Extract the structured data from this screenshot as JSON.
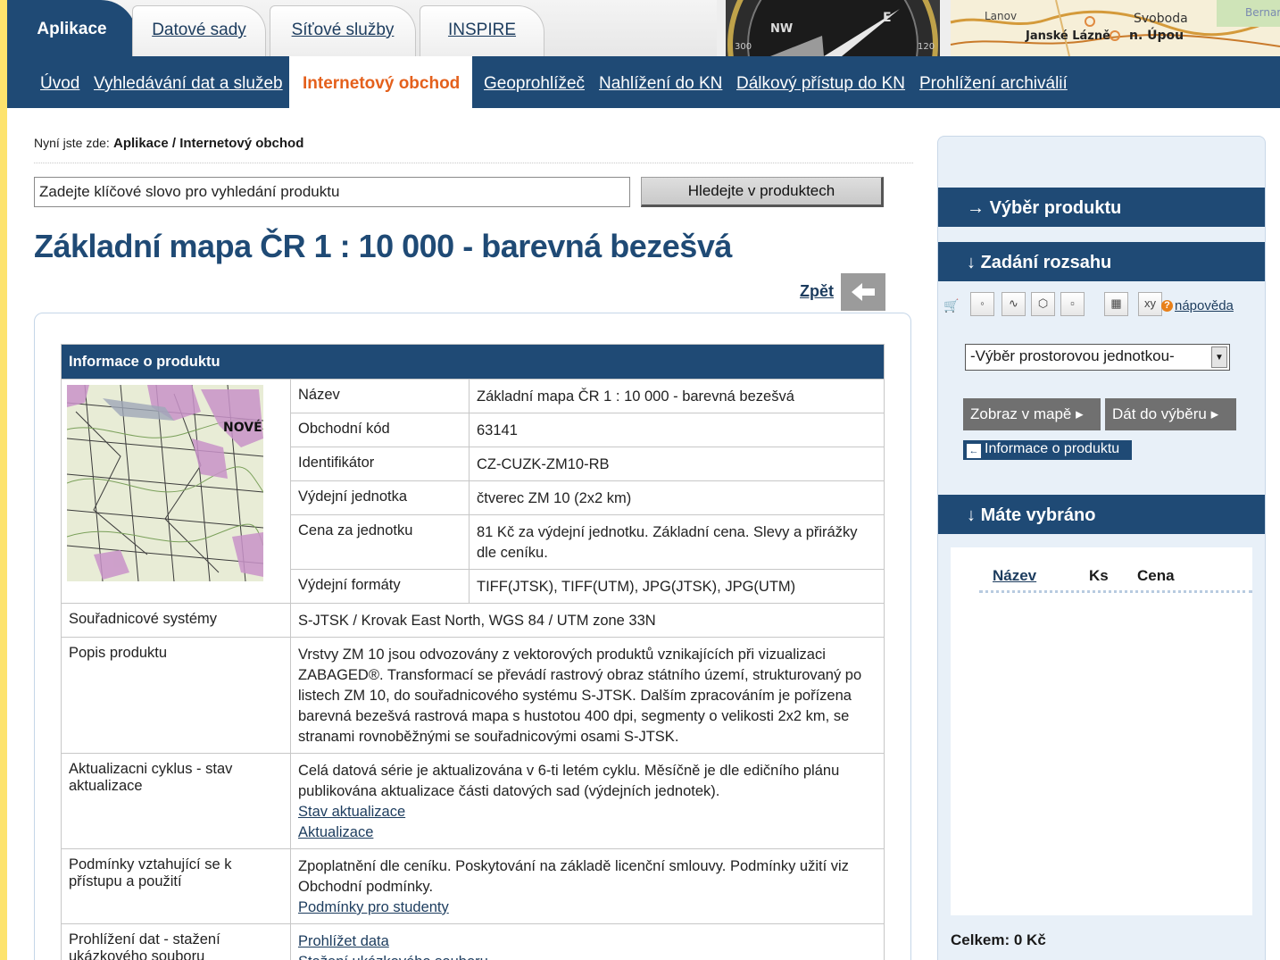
{
  "top_tabs": [
    {
      "label": "Aplikace",
      "active": true
    },
    {
      "label": "Datové sady",
      "active": false
    },
    {
      "label": "Síťové služby",
      "active": false
    },
    {
      "label": "INSPIRE",
      "active": false
    }
  ],
  "header_map_labels": [
    "Lanov",
    "Svoboda",
    "Janské Lázně",
    "n. Úpou",
    "Bernart"
  ],
  "nav": [
    {
      "label": "Úvod",
      "active": false
    },
    {
      "label": "Vyhledávání dat a služeb",
      "active": false
    },
    {
      "label": "Internetový obchod",
      "active": true
    },
    {
      "label": "Geoprohlížeč",
      "active": false
    },
    {
      "label": "Nahlížení do KN",
      "active": false
    },
    {
      "label": "Dálkový přístup do KN",
      "active": false
    },
    {
      "label": "Prohlížení archiválií",
      "active": false
    }
  ],
  "breadcrumb": {
    "prefix": "Nyní jste zde:",
    "path": "Aplikace / Internetový obchod"
  },
  "search": {
    "value": "Zadejte klíčové slovo pro vyhledání produktu",
    "button": "Hledejte v produktech"
  },
  "page_title": "Základní mapa ČR 1 : 10 000 - barevná bezešvá",
  "back_label": "Zpět",
  "product": {
    "header": "Informace o produktu",
    "image_label": "NOVÉ",
    "basic": [
      {
        "label": "Název",
        "value": "Základní mapa ČR 1 : 10 000 - barevná bezešvá"
      },
      {
        "label": "Obchodní kód",
        "value": "63141"
      },
      {
        "label": "Identifikátor",
        "value": "CZ-CUZK-ZM10-RB"
      },
      {
        "label": "Výdejní jednotka",
        "value": "čtverec ZM 10 (2x2 km)"
      },
      {
        "label": "Cena za jednotku",
        "value": "81 Kč za výdejní jednotku. Základní cena. Slevy a přirážky dle ceníku."
      },
      {
        "label": "Výdejní formáty",
        "value": "TIFF(JTSK), TIFF(UTM), JPG(JTSK), JPG(UTM)"
      }
    ],
    "coord_label": "Souřadnicové systémy",
    "coord_value": "S-JTSK / Krovak East North, WGS 84 / UTM zone 33N",
    "desc_label": "Popis produktu",
    "desc_value": "Vrstvy ZM 10 jsou odvozovány z vektorových produktů vznikajících při vizualizaci ZABAGED®. Transformací se převádí rastrový obraz státního území, strukturovaný po listech ZM 10, do souřadnicového systému S-JTSK. Dalším zpracováním je pořízena barevná bezešvá rastrová mapa s hustotou 400 dpi, segmenty o velikosti 2x2 km, se stranami rovnoběžnými se souřadnicovými osami S-JTSK.",
    "update_label": "Aktualizacni cyklus - stav aktualizace",
    "update_value": "Celá datová série je aktualizována v 6-ti letém cyklu. Měsíčně je dle edičního plánu publikována aktualizace části datových sad (výdejních jednotek).",
    "update_link1": "Stav aktualizace",
    "update_link2": "Aktualizace",
    "terms_label": "Podmínky vztahující se k přístupu a použití",
    "terms_value": "Zpoplatnění dle ceníku. Poskytování na základě licenční smlouvy. Podmínky užití viz Obchodní podmínky.",
    "terms_link": "Podmínky pro studenty",
    "preview_label": "Prohlížení dat - stažení ukázkového souboru",
    "preview_link1": "Prohlížet data",
    "preview_link2": "Stažení ukázkového souboru"
  },
  "sidebar": {
    "step1": "Výběr produktu",
    "step2": "Zadání rozsahu",
    "help": "nápověda",
    "select_value": "-Výběr prostorovou jednotkou-",
    "show_in_map": "Zobraz v mapě",
    "add_to_selection": "Dát do výběru",
    "product_info": "Informace o produktu",
    "step3": "Máte vybráno",
    "col_name": "Název",
    "col_qty": "Ks",
    "col_price": "Cena",
    "total": "Celkem: 0 Kč",
    "step_arrow_right": "→",
    "step_arrow_down": "↓"
  },
  "colors": {
    "brand_blue": "#1f4a75",
    "accent_orange": "#e4601c",
    "frame_yellow": "#fde36d"
  }
}
